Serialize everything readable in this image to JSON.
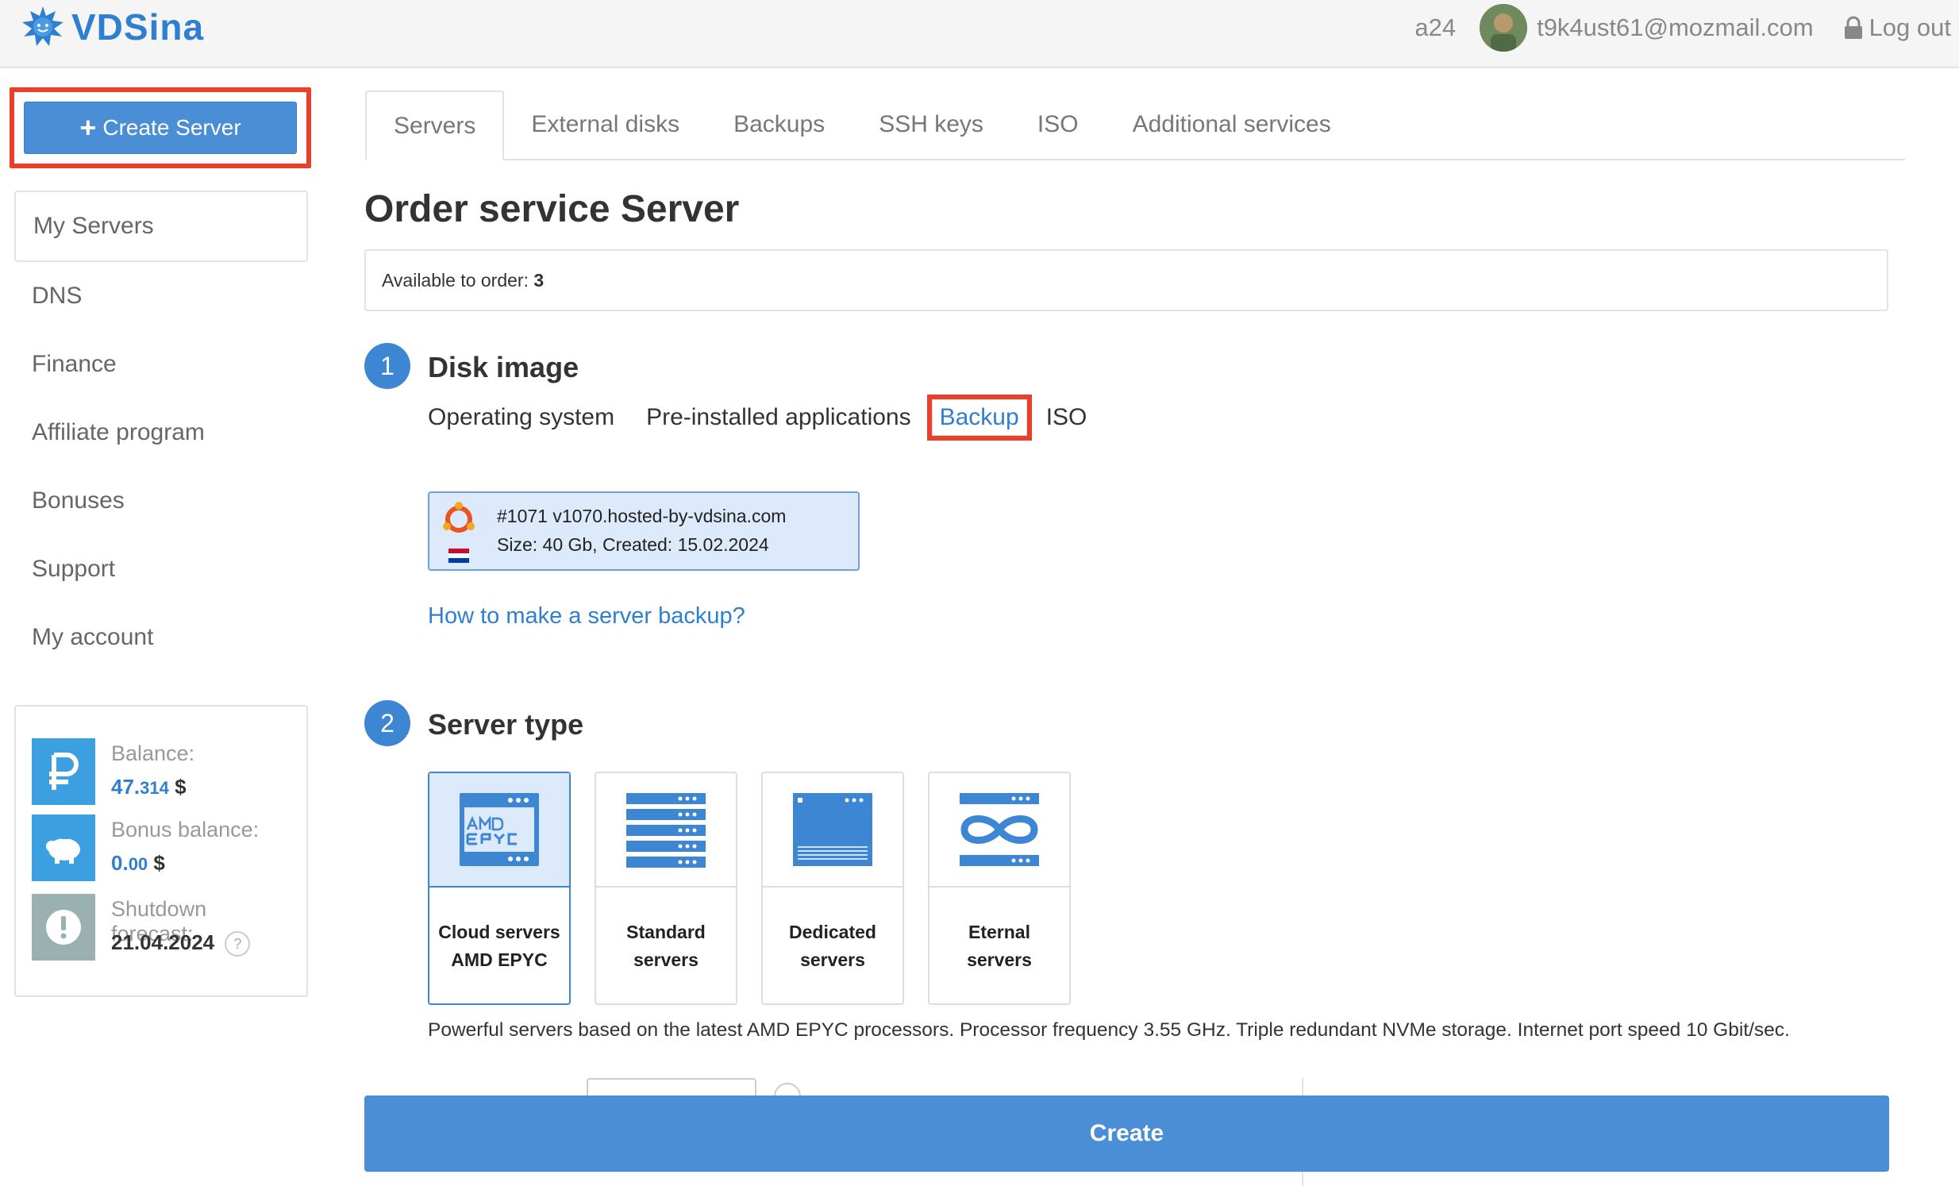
{
  "header": {
    "logo_text": "VDSina",
    "login": "a24",
    "email": "t9k4ust61@mozmail.com",
    "logout_label": "Log out"
  },
  "sidebar": {
    "create_button": "Create Server",
    "items": [
      {
        "label": "My Servers"
      },
      {
        "label": "DNS"
      },
      {
        "label": "Finance"
      },
      {
        "label": "Affiliate program"
      },
      {
        "label": "Bonuses"
      },
      {
        "label": "Support"
      },
      {
        "label": "My account"
      }
    ],
    "balance": {
      "balance_label": "Balance:",
      "balance_main": "47.",
      "balance_frac": "314",
      "balance_currency": "$",
      "bonus_label": "Bonus balance:",
      "bonus_main": "0.",
      "bonus_frac": "00",
      "bonus_currency": "$",
      "shutdown_label": "Shutdown forecast:",
      "shutdown_date": "21.04.2024",
      "help_glyph": "?"
    }
  },
  "tabs": [
    {
      "label": "Servers"
    },
    {
      "label": "External disks"
    },
    {
      "label": "Backups"
    },
    {
      "label": "SSH keys"
    },
    {
      "label": "ISO"
    },
    {
      "label": "Additional services"
    }
  ],
  "main": {
    "title": "Order service Server",
    "available_label": "Available to order:",
    "available_count": "3",
    "step1": {
      "number": "1",
      "title": "Disk image",
      "image_tabs": [
        {
          "label": "Operating system"
        },
        {
          "label": "Pre-installed applications"
        },
        {
          "label": "Backup"
        },
        {
          "label": "ISO"
        }
      ],
      "backup": {
        "line1": "#1071 v1070.hosted-by-vdsina.com",
        "line2": "Size: 40 Gb, Created: 15.02.2024"
      },
      "help_link": "How to make a server backup?"
    },
    "step2": {
      "number": "2",
      "title": "Server type",
      "types": [
        {
          "label": "Cloud servers AMD EPYC"
        },
        {
          "label": "Standard servers"
        },
        {
          "label": "Dedicated servers"
        },
        {
          "label": "Eternal servers"
        }
      ],
      "description": "Powerful servers based on the latest AMD EPYC processors. Processor frequency 3.55 GHz. Triple redundant NVMe storage. Internet port speed 10 Gbit/sec."
    },
    "create_button": "Create"
  },
  "colors": {
    "accent": "#3c86d3",
    "button": "#4a8ed6",
    "highlight": "#e8402a",
    "selected_bg": "#ddeafb"
  }
}
